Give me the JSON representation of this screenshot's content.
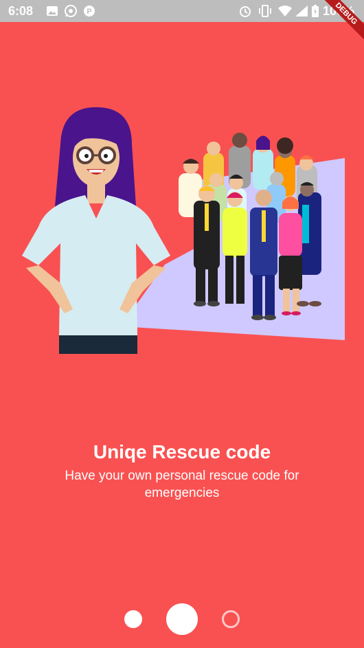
{
  "status_bar": {
    "time": "6:08",
    "battery": "100%"
  },
  "debug_banner": "DEBUG",
  "onboarding": {
    "title": "Uniqe Rescue code",
    "subtitle": "Have your own personal rescue code for emergencies"
  },
  "pager": {
    "page_count": 3,
    "active_index": 1
  },
  "colors": {
    "background": "#f95151",
    "status_bar": "#bdbdbd",
    "accent_panel": "#cfc9ff"
  }
}
